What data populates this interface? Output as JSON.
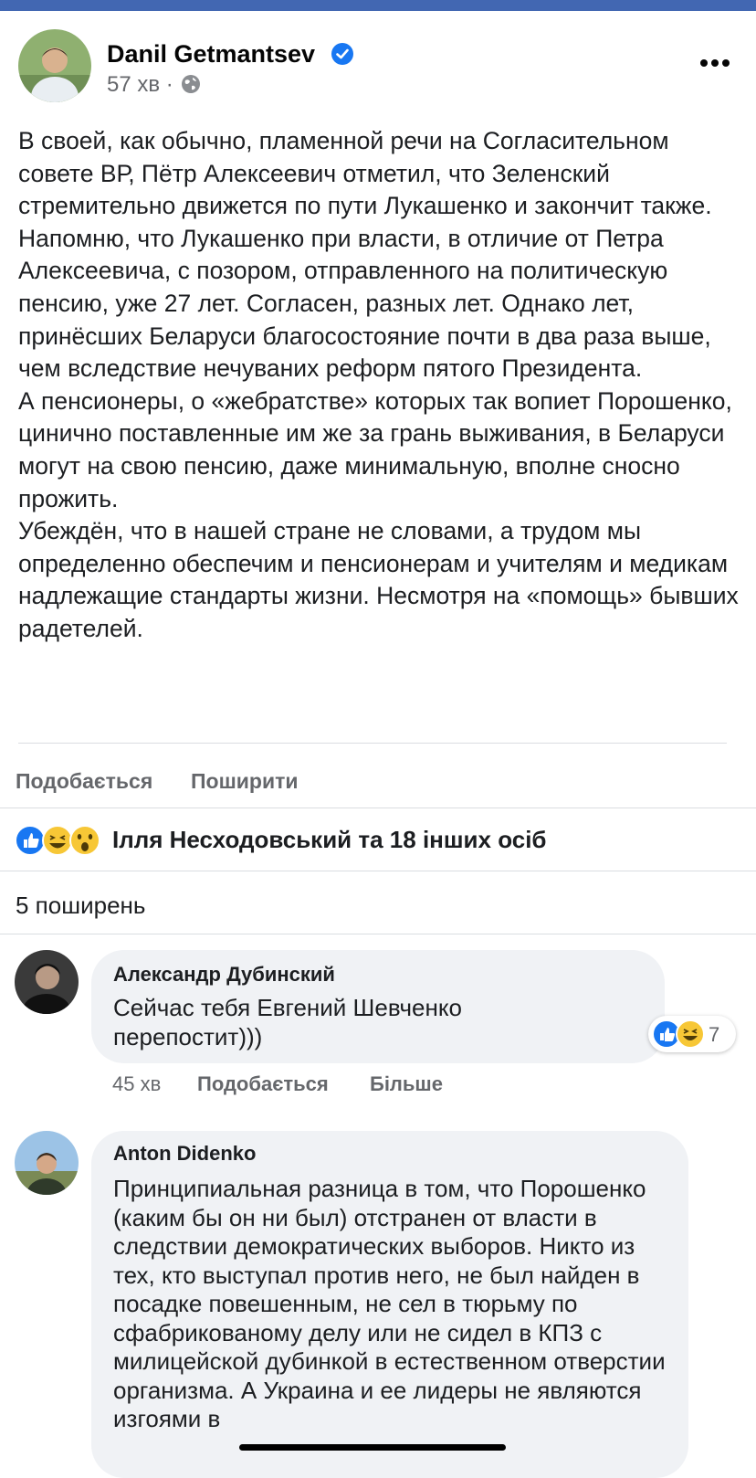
{
  "post": {
    "author": "Danil Getmantsev",
    "time": "57 хв",
    "meta_separator": "·",
    "paragraphs": [
      "В своей, как обычно, пламенной речи на Согласительном совете ВР, Пётр Алексеевич отметил, что Зеленский стремительно движется по пути Лукашенко и закончит также.",
      "Напомню, что Лукашенко при власти, в отличие от Петра Алексеевича, с позором, отправленного на политическую пенсию, уже 27 лет. Согласен, разных лет. Однако лет, принёсших Беларуси благосостояние почти в два раза выше, чем вследствие нечуваних реформ пятого Президента.",
      "А пенсионеры, о «жебратстве» которых так вопиет Порошенко, цинично поставленные им же за грань выживания, в Беларуси могут на свою пенсию, даже минимальную, вполне сносно прожить.",
      "Убеждён, что в нашей стране не словами, а трудом мы определенно обеспечим и пенсионерам и учителям и медикам надлежащие стандарты жизни. Несмотря на «помощь» бывших радетелей."
    ],
    "like_label": "Подобається",
    "share_label": "Поширити",
    "reactions_text": "Ілля Несходовський та 18 інших осіб",
    "shares_text": "5 поширень"
  },
  "comments": [
    {
      "author": "Александр Дубинский",
      "text": "Сейчас тебя Евгений Шевченко перепостит)))",
      "time": "45 хв",
      "like_label": "Подобається",
      "more_label": "Більше",
      "reaction_count": "7"
    },
    {
      "author": "Anton Didenko",
      "text": "Принципиальная разница в том, что Порошенко (каким бы он ни был) отстранен от власти в следствии демократических выборов. Никто из тех, кто выступал против него, не был найден в посадке повешенным, не сел в тюрьму по сфабрикованому делу или не сидел в КПЗ с милицейской дубинкой в естественном отверстии организма. А Украина и ее лидеры не являются изгоями в"
    }
  ],
  "colors": {
    "brand_blue": "#4267b2",
    "verified_blue": "#1877f2",
    "secondary_text": "#65676b",
    "bubble_bg": "#f0f2f5"
  },
  "icons": [
    "verified-icon",
    "globe-icon",
    "more-icon",
    "like-reaction-icon",
    "haha-reaction-icon",
    "wow-reaction-icon"
  ]
}
